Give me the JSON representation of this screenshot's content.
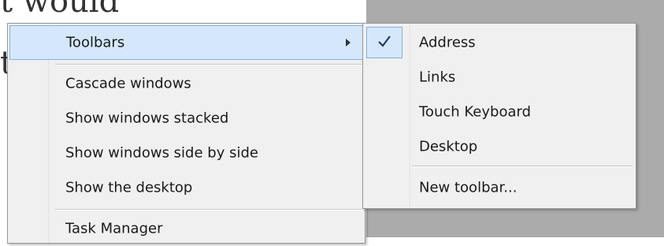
{
  "background": {
    "text_line_1": "t would",
    "text_line_2": "t"
  },
  "context_menu": {
    "items": [
      {
        "label": "Toolbars",
        "has_submenu": true,
        "highlighted": true
      },
      {
        "label": "Cascade windows"
      },
      {
        "label": "Show windows stacked"
      },
      {
        "label": "Show windows side by side"
      },
      {
        "label": "Show the desktop"
      },
      {
        "label": "Task Manager"
      }
    ]
  },
  "toolbars_submenu": {
    "items": [
      {
        "label": "Address",
        "checked": true
      },
      {
        "label": "Links",
        "checked": false
      },
      {
        "label": "Touch Keyboard",
        "checked": false
      },
      {
        "label": "Desktop",
        "checked": false
      },
      {
        "label": "New toolbar...",
        "checked": false
      }
    ]
  },
  "colors": {
    "highlight": "#d5e8fb",
    "highlight_border": "#7fb0e6",
    "menu_bg": "#f0f0f0",
    "panel_gray": "#ababab"
  }
}
